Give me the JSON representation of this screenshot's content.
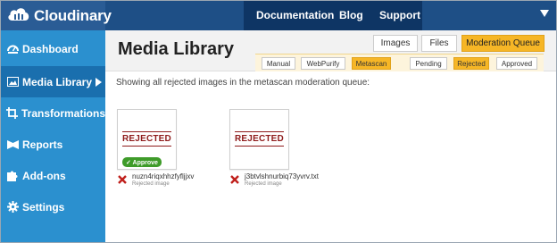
{
  "app": {
    "logo_text": "Cloudinary",
    "brand_color": "#1e4f86",
    "accent_color": "#f6b626"
  },
  "topnav": {
    "items": [
      "Documentation",
      "Blog",
      "Support"
    ],
    "dropdown_icon": "triangle-down-icon"
  },
  "sidebar": {
    "items": [
      {
        "label": "Dashboard",
        "icon": "dashboard-icon"
      },
      {
        "label": "Media Library",
        "icon": "media-library-icon",
        "active": true
      },
      {
        "label": "Transformations",
        "icon": "crop-icon"
      },
      {
        "label": "Reports",
        "icon": "reports-icon"
      },
      {
        "label": "Add-ons",
        "icon": "puzzle-icon"
      },
      {
        "label": "Settings",
        "icon": "gear-icon"
      }
    ]
  },
  "main": {
    "title": "Media Library",
    "tabs": [
      {
        "label": "Images",
        "active": false
      },
      {
        "label": "Files",
        "active": false
      },
      {
        "label": "Moderation Queue",
        "active": true
      }
    ],
    "moderation_types": [
      {
        "label": "Manual",
        "active": false
      },
      {
        "label": "WebPurify",
        "active": false
      },
      {
        "label": "Metascan",
        "active": true
      }
    ],
    "status_filters": [
      {
        "label": "Pending",
        "active": false
      },
      {
        "label": "Rejected",
        "active": true
      },
      {
        "label": "Approved",
        "active": false
      }
    ],
    "description": "Showing all rejected images in the metascan moderation queue:",
    "items": [
      {
        "stamp": "REJECTED",
        "approve_label": "✓ Approve",
        "filename": "nuzn4riqxhhzfyfljjxv",
        "status": "Rejected image",
        "status_icon": "reject-x-icon"
      },
      {
        "stamp": "REJECTED",
        "filename": "j3btvlshnurbiq73yvrv.txt",
        "status": "Rejected image",
        "status_icon": "reject-x-icon"
      }
    ]
  }
}
